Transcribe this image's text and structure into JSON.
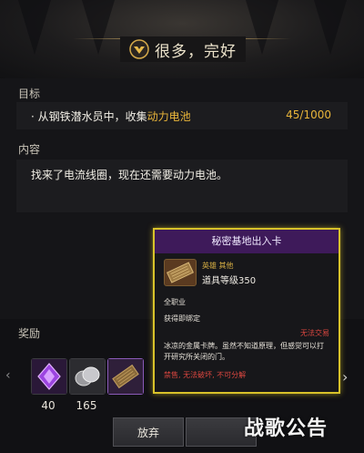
{
  "header": {
    "title": "很多，完好"
  },
  "objective": {
    "label": "目标",
    "text_prefix": "· 从钢铁潜水员中，收集",
    "text_highlight": "动力电池",
    "count": "45/1000"
  },
  "content": {
    "label": "内容",
    "text": "找来了电流线圈，现在还需要动力电池。"
  },
  "rewards": {
    "label": "奖励",
    "items": [
      {
        "icon": "crystal-icon",
        "count": "40"
      },
      {
        "icon": "silver-coins-icon",
        "count": "165"
      },
      {
        "icon": "key-card-icon",
        "count": ""
      }
    ]
  },
  "buttons": {
    "abandon": "放弃"
  },
  "tooltip": {
    "title": "秘密基地出入卡",
    "rarity": "英雄  其他",
    "item_level": "道具等级350",
    "class": "全职业",
    "bind": "获得即绑定",
    "trade": "无法交易",
    "description": "冰凉的金属卡牌。虽然不知道原理，但感觉可以打开研究所关闭的门。",
    "restrictions": "禁售, 无法破坏, 不可分解"
  },
  "watermark": "战歌公告",
  "colors": {
    "accent_gold": "#e9b53a",
    "tooltip_border": "#d8c22a",
    "tooltip_header": "#3e1a5a",
    "warning_red": "#d9463f"
  }
}
